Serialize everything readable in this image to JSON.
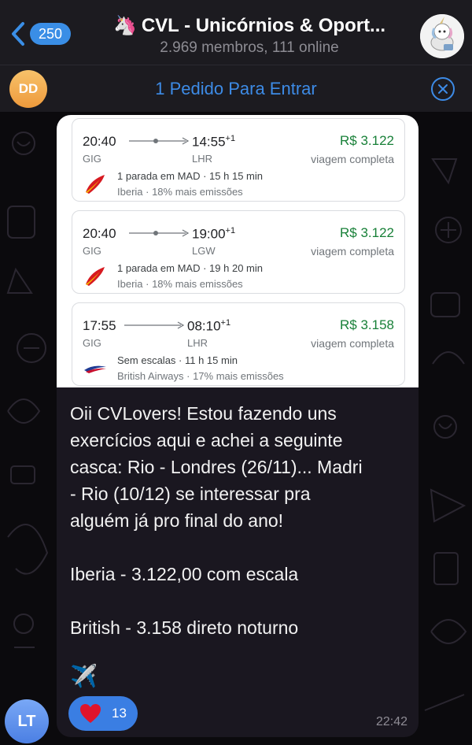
{
  "header": {
    "back_count": "250",
    "title_emoji": "🦄",
    "title": "CVL - Unicórnios & Oport...",
    "subtitle": "2.969 membros, 111 online"
  },
  "join_bar": {
    "avatar_initials": "DD",
    "text": "1 Pedido Para Entrar"
  },
  "message": {
    "flights": [
      {
        "dep_time": "20:40",
        "arr_time": "14:55",
        "day_offset": "+1",
        "from": "GIG",
        "to": "LHR",
        "price": "R$ 3.122",
        "price_note": "viagem completa",
        "stops": "1 parada em MAD · 15 h 15 min",
        "airline": "Iberia · 18% mais emissões",
        "logo": "iberia-logo",
        "has_stop": true
      },
      {
        "dep_time": "20:40",
        "arr_time": "19:00",
        "day_offset": "+1",
        "from": "GIG",
        "to": "LGW",
        "price": "R$ 3.122",
        "price_note": "viagem completa",
        "stops": "1 parada em MAD · 19 h 20 min",
        "airline": "Iberia · 18% mais emissões",
        "logo": "iberia-logo",
        "has_stop": true
      },
      {
        "dep_time": "17:55",
        "arr_time": "08:10",
        "day_offset": "+1",
        "from": "GIG",
        "to": "LHR",
        "price": "R$ 3.158",
        "price_note": "viagem completa",
        "stops": "Sem escalas · 11 h 15 min",
        "airline": "British Airways · 17% mais emissões",
        "logo": "british-airways-logo",
        "has_stop": false
      }
    ],
    "text_lines": [
      "Oii CVLovers! Estou fazendo uns",
      "exercícios aqui e achei a seguinte",
      "casca: Rio - Londres (26/11)... Madri",
      "- Rio (10/12) se interessar pra",
      "alguém já pro final do ano!",
      "",
      "Iberia - 3.122,00 com escala",
      "",
      "British - 3.158 direto noturno"
    ],
    "emoji": "✈️",
    "reaction": {
      "icon": "heart-icon",
      "count": "13"
    },
    "time": "22:42",
    "sender_initials": "LT"
  },
  "colors": {
    "accent": "#3d8be6",
    "price_green": "#188038",
    "bubble_bg": "#1a1720",
    "header_bg": "#1c1b20"
  }
}
